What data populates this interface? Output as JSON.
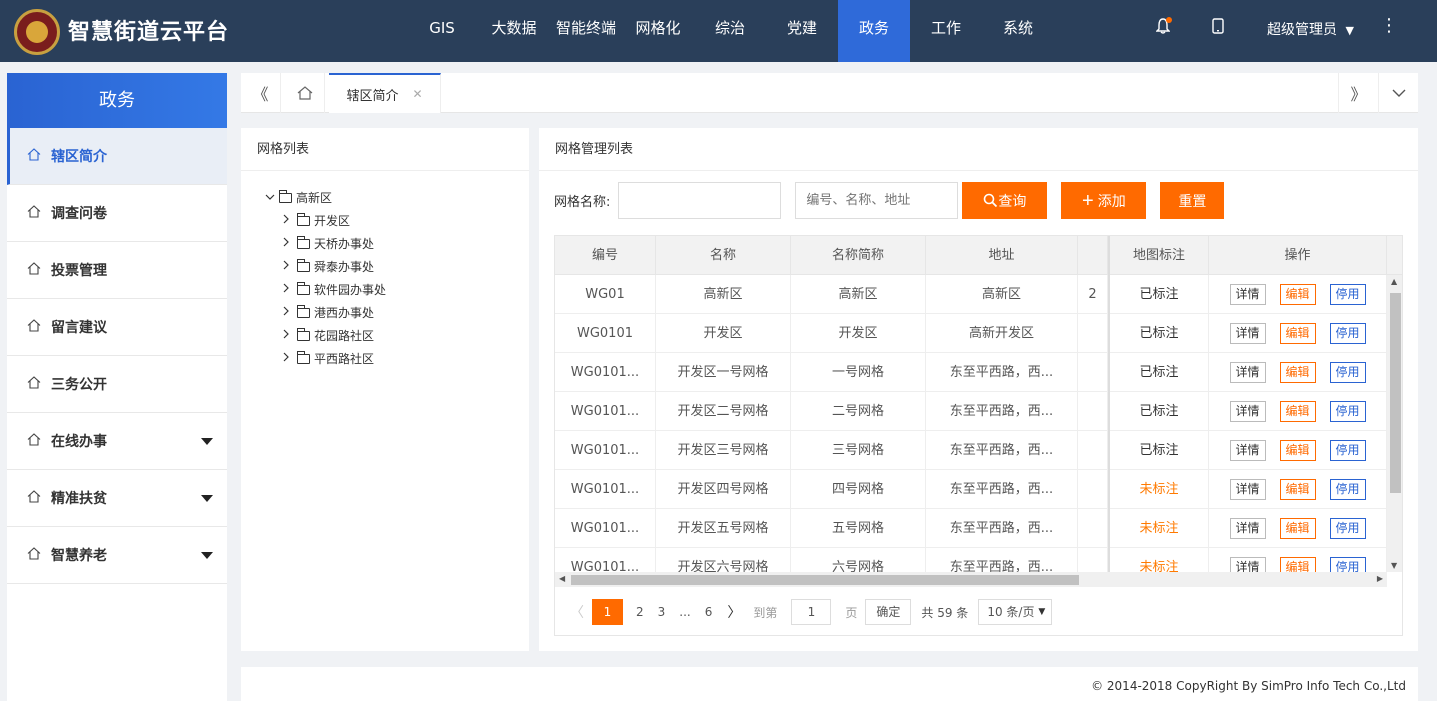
{
  "app": {
    "title": "智慧街道云平台"
  },
  "nav": {
    "items": [
      "GIS",
      "大数据",
      "智能终端",
      "网格化",
      "综治",
      "党建",
      "政务",
      "工作",
      "系统"
    ],
    "active_index": 6
  },
  "topbar": {
    "user_name": "超级管理员"
  },
  "sidebar": {
    "title": "政务",
    "items": [
      {
        "label": "辖区简介",
        "active": true,
        "expandable": false
      },
      {
        "label": "调查问卷",
        "active": false,
        "expandable": false
      },
      {
        "label": "投票管理",
        "active": false,
        "expandable": false
      },
      {
        "label": "留言建议",
        "active": false,
        "expandable": false
      },
      {
        "label": "三务公开",
        "active": false,
        "expandable": false
      },
      {
        "label": "在线办事",
        "active": false,
        "expandable": true
      },
      {
        "label": "精准扶贫",
        "active": false,
        "expandable": true
      },
      {
        "label": "智慧养老",
        "active": false,
        "expandable": true
      }
    ]
  },
  "tabs": {
    "active_label": "辖区简介"
  },
  "left_panel": {
    "title": "网格列表",
    "tree": {
      "root": "高新区",
      "children": [
        "开发区",
        "天桥办事处",
        "舜泰办事处",
        "软件园办事处",
        "港西办事处",
        "花园路社区",
        "平西路社区"
      ]
    }
  },
  "right_panel": {
    "title": "网格管理列表",
    "filter": {
      "name_label": "网格名称:",
      "name_value": "",
      "search_placeholder": "编号、名称、地址",
      "query_label": "查询",
      "add_label": "添加",
      "reset_label": "重置"
    },
    "table": {
      "columns": [
        "编号",
        "名称",
        "名称简称",
        "地址",
        "",
        "地图标注",
        "操作"
      ],
      "rows": [
        {
          "code": "WG01",
          "name": "高新区",
          "short": "高新区",
          "address": "高新区",
          "extra": "2",
          "map_status": "已标注",
          "mapped": true
        },
        {
          "code": "WG0101",
          "name": "开发区",
          "short": "开发区",
          "address": "高新开发区",
          "extra": "",
          "map_status": "已标注",
          "mapped": true
        },
        {
          "code": "WG0101...",
          "name": "开发区一号网格",
          "short": "一号网格",
          "address": "东至平西路，西...",
          "extra": "",
          "map_status": "已标注",
          "mapped": true
        },
        {
          "code": "WG0101...",
          "name": "开发区二号网格",
          "short": "二号网格",
          "address": "东至平西路，西...",
          "extra": "",
          "map_status": "已标注",
          "mapped": true
        },
        {
          "code": "WG0101...",
          "name": "开发区三号网格",
          "short": "三号网格",
          "address": "东至平西路，西...",
          "extra": "",
          "map_status": "已标注",
          "mapped": true
        },
        {
          "code": "WG0101...",
          "name": "开发区四号网格",
          "short": "四号网格",
          "address": "东至平西路，西...",
          "extra": "",
          "map_status": "未标注",
          "mapped": false
        },
        {
          "code": "WG0101...",
          "name": "开发区五号网格",
          "short": "五号网格",
          "address": "东至平西路，西...",
          "extra": "",
          "map_status": "未标注",
          "mapped": false
        },
        {
          "code": "WG0101...",
          "name": "开发区六号网格",
          "short": "六号网格",
          "address": "东至平西路，西...",
          "extra": "",
          "map_status": "未标注",
          "mapped": false
        }
      ],
      "op_labels": {
        "detail": "详情",
        "edit": "编辑",
        "disable": "停用"
      }
    },
    "pager": {
      "current": "1",
      "pages": [
        "2",
        "3",
        "...",
        "6"
      ],
      "goto_label": "到第",
      "goto_value": "1",
      "page_unit": "页",
      "confirm_label": "确定",
      "total_text": "共 59 条",
      "page_size": "10 条/页"
    }
  },
  "footer": {
    "text": "© 2014-2018 CopyRight By SimPro Info Tech Co.,Ltd"
  },
  "colors": {
    "topbar": "#2a3f5a",
    "accent_blue": "#2f6ad9",
    "accent_orange": "#ff6a00"
  }
}
